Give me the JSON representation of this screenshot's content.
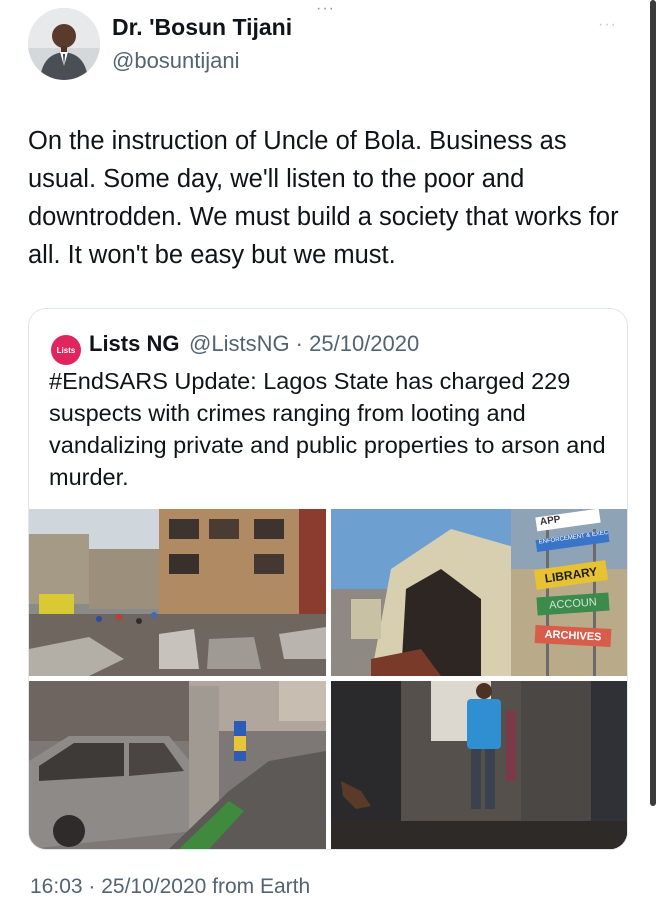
{
  "tweet": {
    "author_name": "Dr. 'Bosun Tijani",
    "author_handle": "@bosuntijani",
    "more_menu": "···",
    "text": "On the instruction of Uncle of Bola. Business as usual. Some day, we'll listen to the poor and downtrodden. We must build a society that works for all. It won't be easy but we must.",
    "timestamp": "16:03 · 25/10/2020 from Earth"
  },
  "quoted_tweet": {
    "logo_text": "Lists",
    "author_name": "Lists NG",
    "handle_date": "@ListsNG · 25/10/2020",
    "text": "#EndSARS Update: Lagos State has charged 229 suspects with crimes ranging from looting and vandalizing private and public properties to arson and murder.",
    "signs": {
      "top": "APP",
      "blue": "ENFORCEMENT & EXECUTION",
      "library": "LIBRARY",
      "account": "ACCOUN",
      "archives": "ARCHIVES"
    }
  },
  "colors": {
    "text_primary": "#0f1419",
    "text_secondary": "#536471",
    "lists_brand": "#e0245e"
  }
}
